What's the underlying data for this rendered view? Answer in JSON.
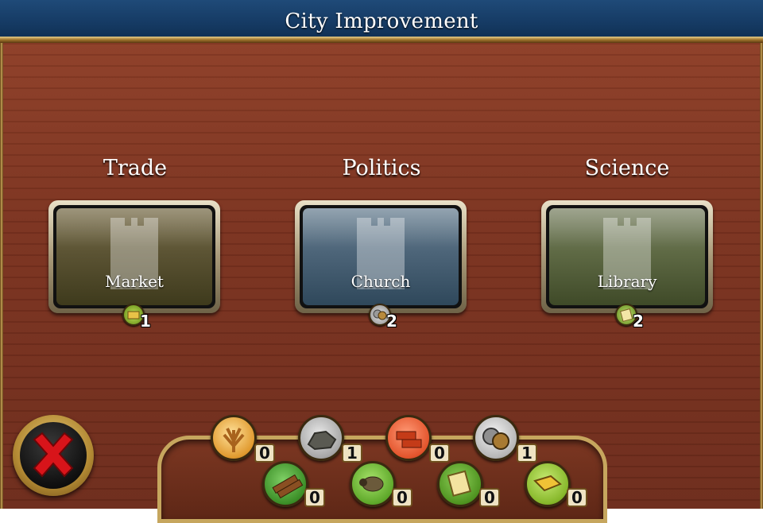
{
  "window": {
    "title": "City Improvement"
  },
  "categories": [
    {
      "title": "Trade",
      "building": "Market",
      "cost_icon": "cloth-icon",
      "cost": "1"
    },
    {
      "title": "Politics",
      "building": "Church",
      "cost_icon": "coin-icon",
      "cost": "2"
    },
    {
      "title": "Science",
      "building": "Library",
      "cost_icon": "paper-icon",
      "cost": "2"
    }
  ],
  "resources": [
    {
      "name": "wheat-icon",
      "count": "0"
    },
    {
      "name": "ore-icon",
      "count": "1"
    },
    {
      "name": "brick-icon",
      "count": "0"
    },
    {
      "name": "coin-icon",
      "count": "1"
    },
    {
      "name": "lumber-icon",
      "count": "0"
    },
    {
      "name": "sheep-icon",
      "count": "0"
    },
    {
      "name": "paper-icon",
      "count": "0"
    },
    {
      "name": "cloth-icon",
      "count": "0"
    }
  ],
  "colors": {
    "header": "#153a63",
    "wood": "#7b321f",
    "gold": "#c6a65e",
    "trade": "#5c5434",
    "politics": "#4d6579",
    "science": "#5f6a45"
  }
}
